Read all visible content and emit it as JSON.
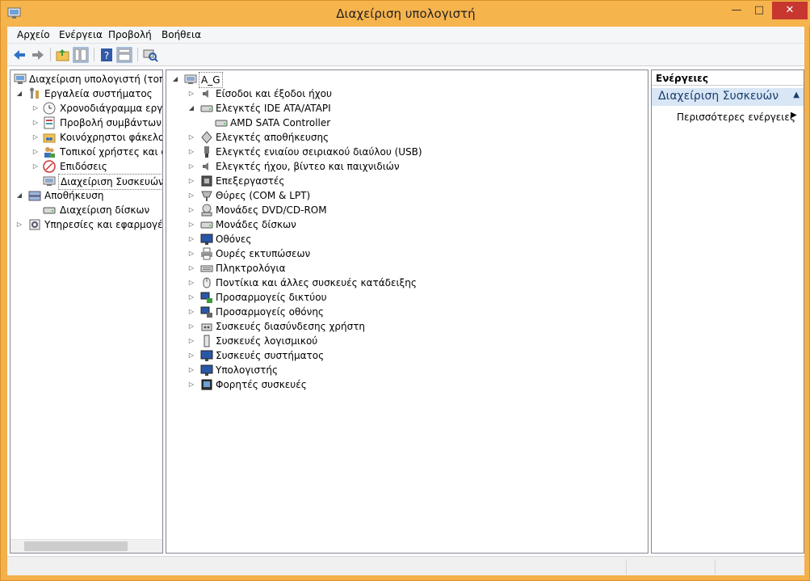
{
  "window": {
    "title": "Διαχείριση υπολογιστή"
  },
  "controls": {
    "minimize": "—",
    "maximize": "□",
    "close": "✕"
  },
  "menu": [
    "Αρχείο",
    "Ενέργεια",
    "Προβολή",
    "Βοήθεια"
  ],
  "left_tree": {
    "root": "Διαχείριση υπολογιστή (τοπικ",
    "system_tools": "Εργαλεία συστήματος",
    "items": [
      "Χρονοδιάγραμμα εργασ",
      "Προβολή συμβάντων",
      "Κοινόχρηστοι φάκελοι",
      "Τοπικοί χρήστες και ομ",
      "Επιδόσεις",
      "Διαχείριση Συσκευών"
    ],
    "storage": "Αποθήκευση",
    "disk_management": "Διαχείριση δίσκων",
    "services": "Υπηρεσίες και εφαρμογές"
  },
  "device_tree": {
    "computer": "A_G",
    "categories": [
      "Είσοδοι και έξοδοι ήχου",
      "Ελεγκτές IDE ATA/ATAPI",
      "AMD SATA Controller",
      "Ελεγκτές αποθήκευσης",
      "Ελεγκτές ενιαίου σειριακού διαύλου (USB)",
      "Ελεγκτές ήχου, βίντεο και παιχνιδιών",
      "Επεξεργαστές",
      "Θύρες (COM & LPT)",
      "Μονάδες DVD/CD-ROM",
      "Μονάδες δίσκων",
      "Οθόνες",
      "Ουρές εκτυπώσεων",
      "Πληκτρολόγια",
      "Ποντίκια και άλλες συσκευές κατάδειξης",
      "Προσαρμογείς δικτύου",
      "Προσαρμογείς οθόνης",
      "Συσκευές διασύνδεσης χρήστη",
      "Συσκευές λογισμικού",
      "Συσκευές συστήματος",
      "Υπολογιστής",
      "Φορητές συσκευές"
    ]
  },
  "actions": {
    "header": "Ενέργειες",
    "section": "Διαχείριση Συσκευών",
    "more": "Περισσότερες ενέργειες"
  }
}
